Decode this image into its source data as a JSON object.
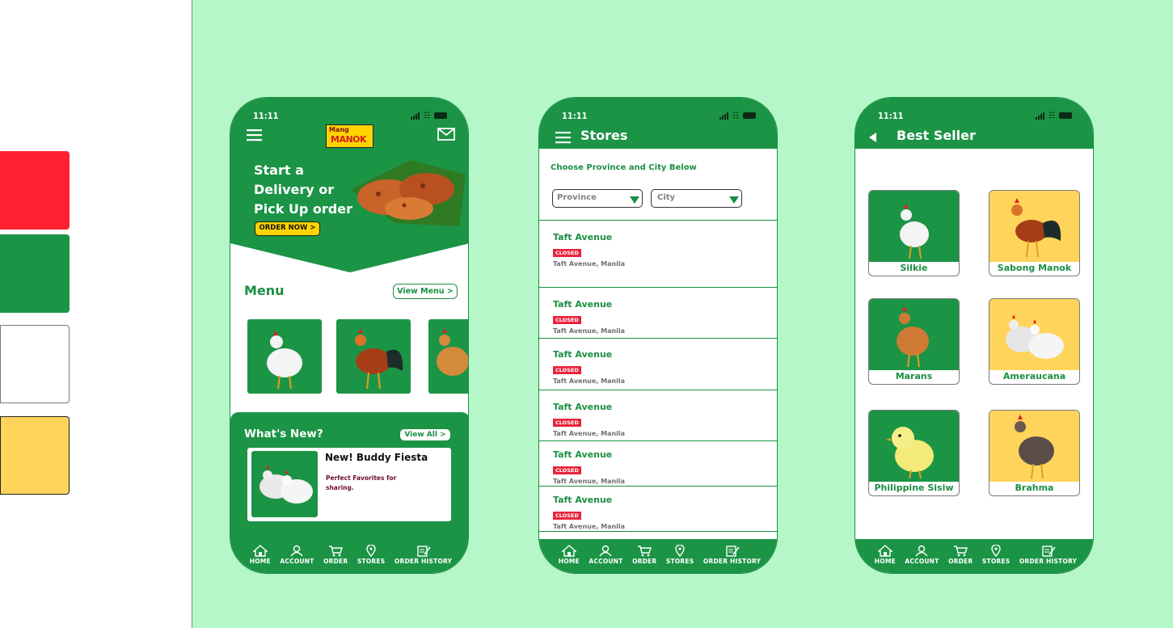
{
  "colors": {
    "red": "#ff212f",
    "green": "#1b9446",
    "white": "#ffffff",
    "yellow": "#ffd45b",
    "background": "#b5f7c8"
  },
  "status_time": "11:11",
  "nav": [
    "HOME",
    "ACCOUNT",
    "ORDER",
    "STORES",
    "ORDER HISTORY"
  ],
  "home": {
    "logo_top": "Mang",
    "logo_bottom": "MANOK",
    "hero_line1": "Start a",
    "hero_line2": "Delivery or",
    "hero_line3": "Pick Up order",
    "order_now": "ORDER NOW >",
    "menu_title": "Menu",
    "view_menu": "View Menu >",
    "whats_new": "What's New?",
    "view_all": "View All >",
    "promo_title": "New! Buddy Fiesta",
    "promo_desc": "Perfect Favorites for sharing."
  },
  "stores": {
    "title": "Stores",
    "choose": "Choose Province and City Below",
    "province": "Province",
    "city": "City",
    "closed": "CLOSED",
    "list": [
      {
        "name": "Taft Avenue",
        "addr": "Taft Avenue, Manila"
      },
      {
        "name": "Taft Avenue",
        "addr": "Taft Avenue, Manila"
      },
      {
        "name": "Taft Avenue",
        "addr": "Taft Avenue, Manila"
      },
      {
        "name": "Taft Avenue",
        "addr": "Taft Avenue, Manila"
      },
      {
        "name": "Taft Avenue",
        "addr": "Taft Avenue, Manila"
      },
      {
        "name": "Taft Avenue",
        "addr": "Taft Avenue, Manila"
      }
    ]
  },
  "best": {
    "title": "Best Seller",
    "items": [
      "Silkie",
      "Sabong Manok",
      "Marans",
      "Ameraucana",
      "Philippine Sisiw",
      "Brahma"
    ]
  }
}
